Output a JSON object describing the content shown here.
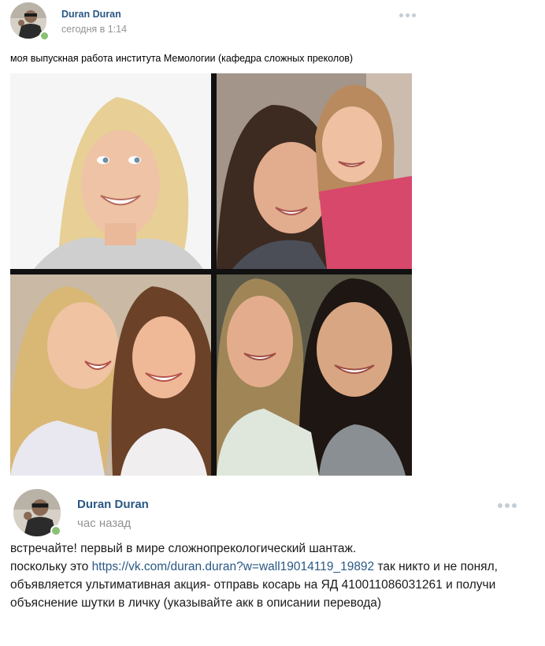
{
  "post1": {
    "author": "Duran Duran",
    "time": "сегодня в 1:14",
    "text": "моя выпускная работа института Мемологии (кафедра сложных преколов)",
    "online": true,
    "photos": [
      "smiling-blonde-woman",
      "mother-and-daughter",
      "two-women-laughing",
      "two-women-smiling"
    ]
  },
  "post2": {
    "author": "Duran Duran",
    "time": "час назад",
    "online": true,
    "text_before": "встречайте! первый в мире сложнопрекологический шантаж.",
    "text_line2_prefix": "поскольку это ",
    "link": "https://vk.com/duran.duran?w=wall19014119_19892",
    "text_after": " так никто и не понял, объявляется ультимативная акция- отправь косарь на ЯД 410011086031261 и получи объяснение шутки в личку (указывайте акк в описании перевода)"
  },
  "colors": {
    "author": "#2a5885",
    "time": "#939393",
    "online": "#8ac176",
    "menu_dots": "#c5cdd6"
  }
}
